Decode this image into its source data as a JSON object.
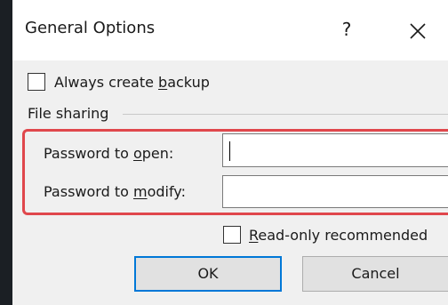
{
  "dialog": {
    "title": "General Options",
    "help_label": "?",
    "close_icon": "close-icon"
  },
  "backup": {
    "checked": false,
    "label_pre": "Always create ",
    "label_acc": "b",
    "label_post": "ackup"
  },
  "file_sharing": {
    "group_label": "File sharing",
    "open_label_pre": "Password to ",
    "open_label_acc": "o",
    "open_label_post": "pen:",
    "open_value": "",
    "modify_label_pre": "Password to ",
    "modify_label_acc": "m",
    "modify_label_post": "odify:",
    "modify_value": ""
  },
  "readonly": {
    "checked": false,
    "label_acc": "R",
    "label_post": "ead-only recommended"
  },
  "buttons": {
    "ok": "OK",
    "cancel": "Cancel"
  },
  "colors": {
    "highlight": "#e0474c",
    "default_button_border": "#0078d7"
  }
}
